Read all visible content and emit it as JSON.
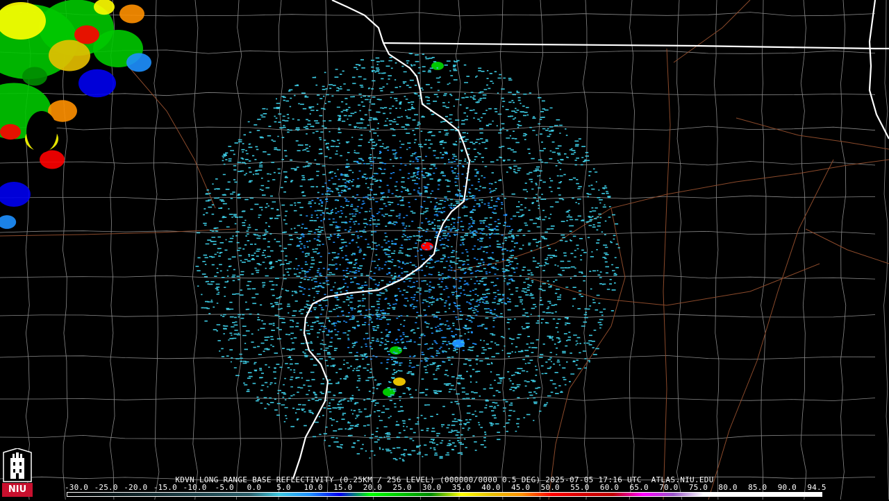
{
  "product": {
    "caption": "KDVN LONG RANGE BASE REFLECTIVITY (0.25KM / 256 LEVEL) (000000/0000 0.5 DEG) 2025-07-05 17:16 UTC  ATLAS.NIU.EDU"
  },
  "logo": {
    "text": "NIU"
  },
  "legend": {
    "ticks": [
      "-30.0",
      "-25.0",
      "-20.0",
      "-15.0",
      "-10.0",
      "-5.0",
      "0.0",
      "5.0",
      "10.0",
      "15.0",
      "20.0",
      "25.0",
      "30.0",
      "35.0",
      "40.0",
      "45.0",
      "50.0",
      "55.0",
      "60.0",
      "65.0",
      "70.0",
      "75.0",
      "80.0",
      "85.0",
      "90.0",
      "94.5"
    ],
    "min": -30.0,
    "max": 94.5,
    "stops": [
      {
        "value": -30,
        "color": "#000000"
      },
      {
        "value": 0,
        "color": "#2b5f6a"
      },
      {
        "value": 5,
        "color": "#3cc8e0"
      },
      {
        "value": 10,
        "color": "#1e90ff"
      },
      {
        "value": 15,
        "color": "#0000f0"
      },
      {
        "value": 20,
        "color": "#00ff00"
      },
      {
        "value": 25,
        "color": "#00c800"
      },
      {
        "value": 30,
        "color": "#008c00"
      },
      {
        "value": 35,
        "color": "#ffff00"
      },
      {
        "value": 40,
        "color": "#e7c000"
      },
      {
        "value": 45,
        "color": "#ff9000"
      },
      {
        "value": 50,
        "color": "#ff0000"
      },
      {
        "value": 55,
        "color": "#d60000"
      },
      {
        "value": 60,
        "color": "#c00000"
      },
      {
        "value": 65,
        "color": "#ff00ff"
      },
      {
        "value": 70,
        "color": "#9955c9"
      },
      {
        "value": 75,
        "color": "#ffffff"
      },
      {
        "value": 94.5,
        "color": "#ffffff"
      }
    ]
  },
  "colors": {
    "background": "#000000",
    "state_border": "#ffffff",
    "county_lines": "#8a8a8a",
    "roads": "#8b4a2b",
    "clutter": "#3cc8e0",
    "logo_red": "#c8102e"
  }
}
